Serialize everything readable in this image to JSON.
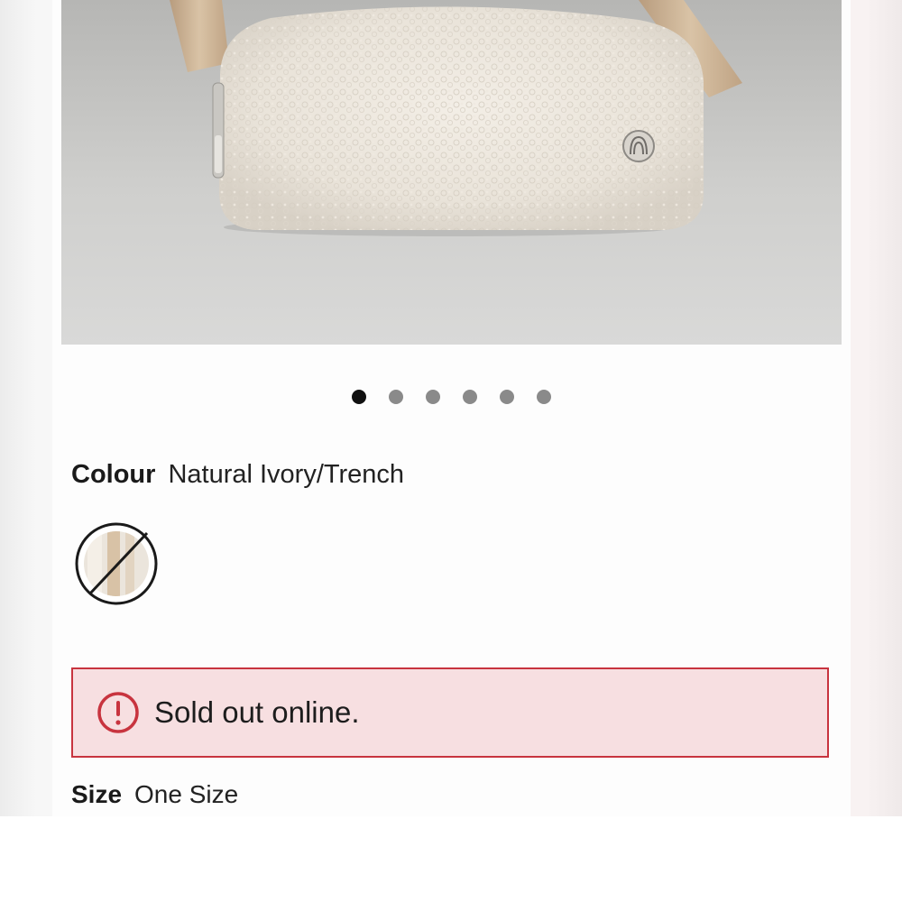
{
  "product": {
    "image_label": "Sherpa belt bag product photo",
    "carousel": {
      "total": 6,
      "active_index": 0
    },
    "colour": {
      "label": "Colour",
      "value": "Natural Ivory/Trench",
      "swatch_icon": "unavailable-swatch"
    },
    "alert": {
      "icon": "exclamation-circle-icon",
      "text": "Sold out online.",
      "border_color": "#c8343f",
      "background_color": "#f7dfe1"
    },
    "size": {
      "label": "Size",
      "value": "One Size"
    }
  }
}
